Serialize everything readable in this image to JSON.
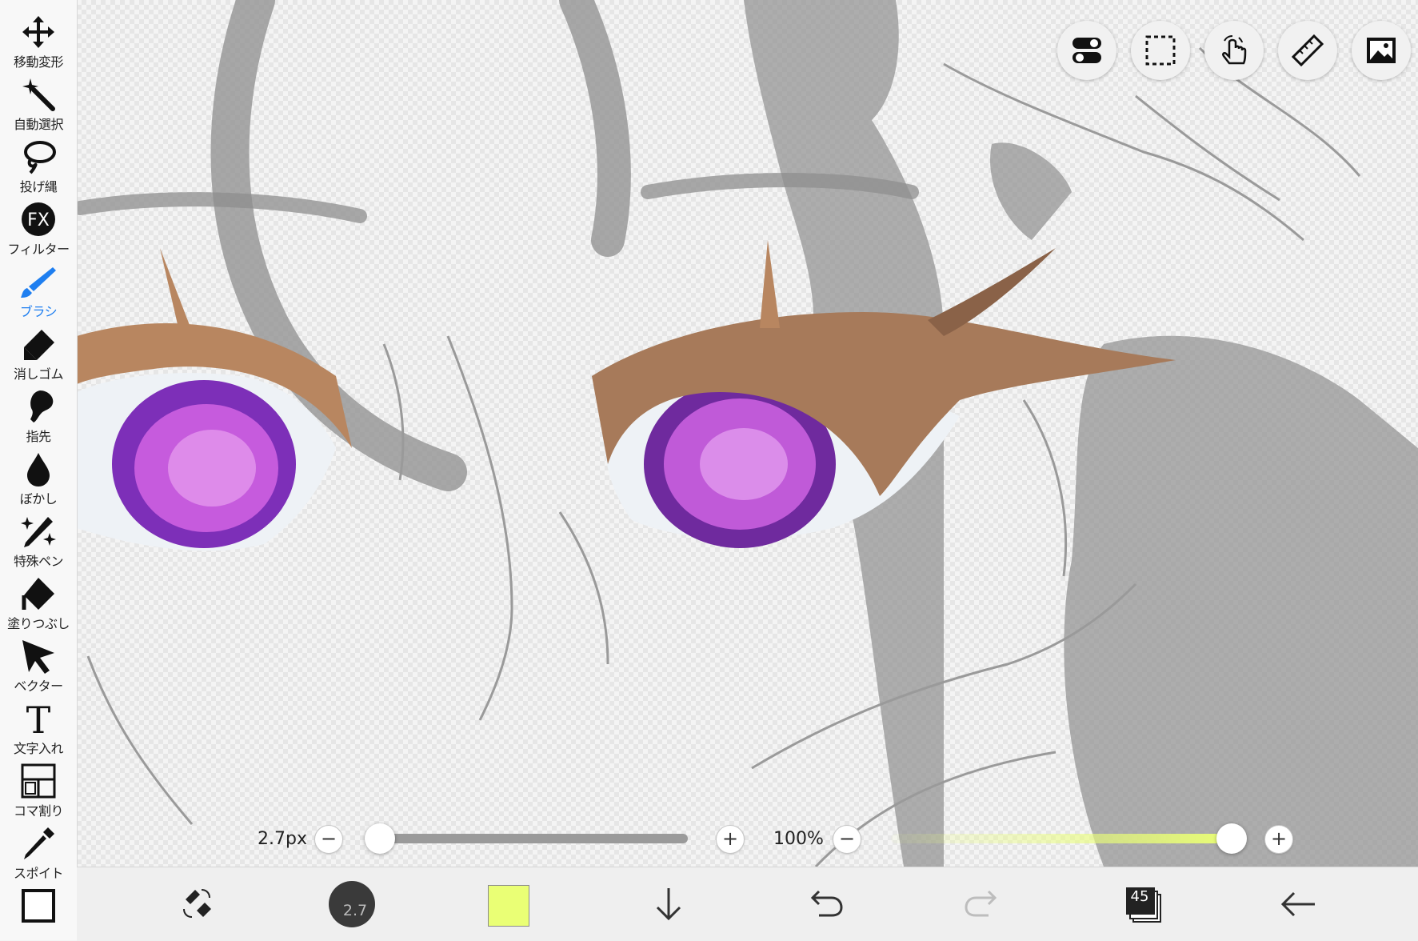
{
  "tools": [
    {
      "label": "移動変形",
      "icon": "move-arrows-icon"
    },
    {
      "label": "自動選択",
      "icon": "magic-wand-icon"
    },
    {
      "label": "投げ縄",
      "icon": "lasso-icon"
    },
    {
      "label": "フィルター",
      "icon": "fx-icon",
      "icon_text": "FX"
    },
    {
      "label": "ブラシ",
      "icon": "brush-icon",
      "active": true
    },
    {
      "label": "消しゴム",
      "icon": "eraser-icon"
    },
    {
      "label": "指先",
      "icon": "finger-icon"
    },
    {
      "label": "ぼかし",
      "icon": "blur-drop-icon"
    },
    {
      "label": "特殊ペン",
      "icon": "special-pen-icon"
    },
    {
      "label": "塗りつぶし",
      "icon": "fill-bucket-icon"
    },
    {
      "label": "ベクター",
      "icon": "vector-cursor-icon"
    },
    {
      "label": "文字入れ",
      "icon": "text-icon",
      "icon_text": "T"
    },
    {
      "label": "コマ割り",
      "icon": "panel-divide-icon"
    },
    {
      "label": "スポイト",
      "icon": "eyedropper-icon"
    }
  ],
  "top_buttons": [
    "toggle-settings-icon",
    "selection-rect-icon",
    "touch-gesture-icon",
    "ruler-icon",
    "image-material-icon"
  ],
  "brush": {
    "size_text": "2.7px",
    "size_fraction": 0.03,
    "opacity_text": "100%",
    "opacity_fraction": 1.0,
    "minus": "−",
    "plus": "+"
  },
  "bottom": {
    "brush_size_badge": "2.7",
    "color": "#eaff75",
    "layer_count": "45"
  },
  "colors": {
    "active_tool": "#1f7ff0",
    "primary_color": "#eaff75"
  }
}
